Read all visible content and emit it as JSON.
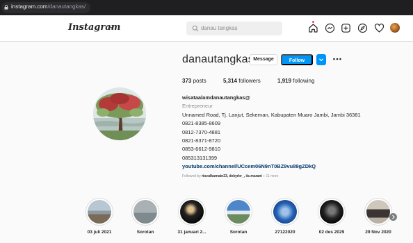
{
  "browser": {
    "url_host": "instagram.com",
    "url_path": "/danautangkas/"
  },
  "header": {
    "logo": "Instagram",
    "search_placeholder": "danau tangkas",
    "icons": [
      "home-icon",
      "messenger-icon",
      "new-post-icon",
      "explore-icon",
      "activity-heart-icon",
      "profile-avatar"
    ]
  },
  "profile": {
    "username": "danautangkas",
    "message_label": "Message",
    "follow_label": "Follow",
    "stats": {
      "posts_count": "373",
      "posts_label": "posts",
      "followers_count": "5,314",
      "followers_label": "followers",
      "following_count": "1,919",
      "following_label": "following"
    },
    "bio": {
      "name": "wisataalamdanautangkas@",
      "category": "Entrepreneur",
      "address": "Unnamed Road, Tj. Lanjut, Sekernan, Kabupaten Muaro Jambi, Jambi 36381",
      "phones": [
        "0821-8385-8609",
        "0812-7370-4881",
        "0821-8371-8720",
        "0853-6612-9810",
        "085313131399"
      ],
      "link": "youtube.com/channel/UCcem06N9nT0BZ9vu89gZDkQ",
      "followed_prefix": "Followed by",
      "followed_names": "riozulkarnain23, dekyrbr_, iis.marani",
      "followed_more": "+ 11 more"
    }
  },
  "highlights": [
    {
      "label": "03 juli 2021"
    },
    {
      "label": "Sorotan"
    },
    {
      "label": "31 januari 2..."
    },
    {
      "label": "Sorotan"
    },
    {
      "label": "27122020"
    },
    {
      "label": "02 des 2029"
    },
    {
      "label": "29 Nov 2020"
    }
  ],
  "colors": {
    "accent": "#0095f6",
    "link": "#00376b",
    "text": "#262626",
    "muted": "#8e8e8e",
    "background": "#fafafa",
    "notification_dot": "#ed4956"
  }
}
